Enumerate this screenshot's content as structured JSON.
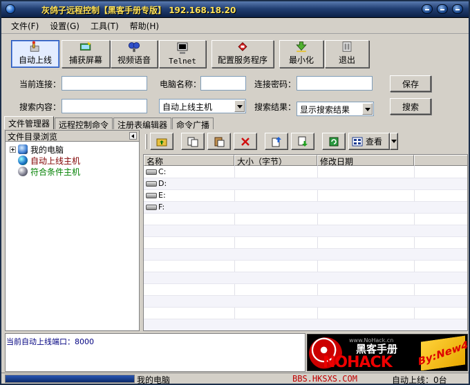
{
  "window": {
    "title": "灰鸽子远程控制【黑客手册专版】",
    "ip": "192.168.18.20"
  },
  "menu": [
    "文件(F)",
    "设置(G)",
    "工具(T)",
    "帮助(H)"
  ],
  "toolbar": [
    {
      "label": "自动上线",
      "icon": "auto-online-icon",
      "active": true
    },
    {
      "label": "捕获屏幕",
      "icon": "capture-screen-icon",
      "active": false
    },
    {
      "label": "视频语音",
      "icon": "video-voice-icon",
      "active": false
    },
    {
      "label": "Telnet",
      "icon": "telnet-icon",
      "active": false
    },
    {
      "label": "配置服务程序",
      "icon": "configure-server-icon",
      "active": false
    },
    {
      "label": "最小化",
      "icon": "minimize-icon",
      "active": false
    },
    {
      "label": "退出",
      "icon": "exit-icon",
      "active": false
    }
  ],
  "form": {
    "current_conn_label": "当前连接：",
    "current_conn_value": "",
    "computer_name_label": "电脑名称：",
    "computer_name_value": "",
    "conn_password_label": "连接密码：",
    "conn_password_value": "",
    "save_label": "保存",
    "search_content_label": "搜索内容：",
    "search_content_value": "",
    "search_scope_value": "自动上线主机",
    "search_result_label": "搜索结果：",
    "search_result_value": "显示搜索结果",
    "search_label": "搜索"
  },
  "tabs": [
    "文件管理器",
    "远程控制命令",
    "注册表编辑器",
    "命令广播"
  ],
  "tree": {
    "header": "文件目录浏览",
    "items": [
      {
        "label": "我的电脑",
        "color": "#000000",
        "icon": "my-computer-icon"
      },
      {
        "label": "自动上线主机",
        "color": "#800000",
        "icon": "online-hosts-icon"
      },
      {
        "label": "符合条件主机",
        "color": "#008000",
        "icon": "matching-hosts-icon"
      }
    ]
  },
  "right_toolbar": {
    "view_label": "查看",
    "buttons": [
      "up-folder-icon",
      "copy-icon",
      "paste-icon",
      "delete-icon",
      "upload-icon",
      "download-icon",
      "refresh-icon"
    ]
  },
  "listview": {
    "columns": [
      "名称",
      "大小（字节）",
      "修改日期"
    ],
    "rows": [
      {
        "name": "C:"
      },
      {
        "name": "D:"
      },
      {
        "name": "E:"
      },
      {
        "name": "F:"
      }
    ]
  },
  "log": {
    "line_label": "当前自动上线端口：",
    "line_value": "8000"
  },
  "banner": {
    "url": "www.NoHack.cn",
    "cn_title": "黑客手册",
    "brand": "NOHACK",
    "signature": "By:New4"
  },
  "status": {
    "computer": "我的电脑",
    "url": "BBS.HKSXS.COM",
    "online": "自动上线：0台"
  }
}
